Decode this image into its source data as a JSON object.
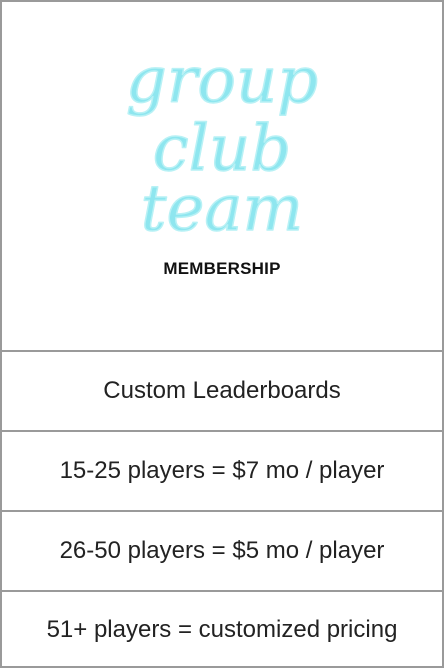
{
  "logo": {
    "lines": [
      "group",
      "club",
      "team"
    ],
    "color": "#8ee6ef"
  },
  "membership_label": "MEMBERSHIP",
  "features": [
    "Custom Leaderboards",
    "15-25 players = $7 mo / player",
    "26-50 players = $5 mo / player",
    "51+ players = customized pricing"
  ]
}
